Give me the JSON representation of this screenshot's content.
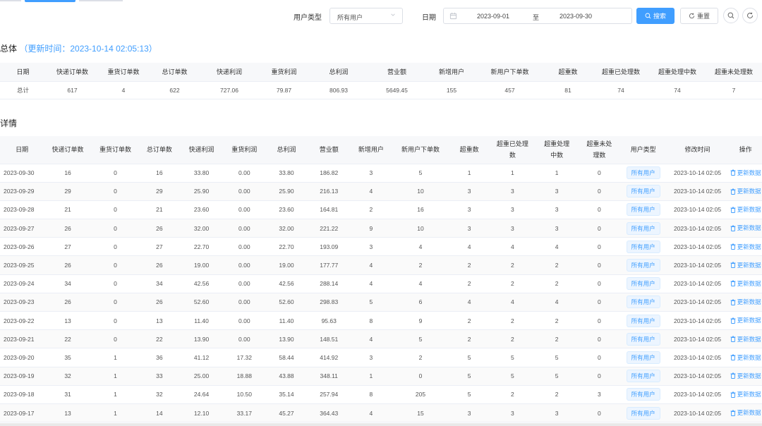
{
  "filters": {
    "user_type_label": "用户类型",
    "user_type_value": "所有用户",
    "date_label": "日期",
    "date_start": "2023-09-01",
    "date_to": "至",
    "date_end": "2023-09-30",
    "search_label": "搜索",
    "reset_label": "重置"
  },
  "overall": {
    "title_prefix": "总体",
    "update_time_label": "（更新时间：2023-10-14 02:05:13）",
    "headers": [
      "日期",
      "快递订单数",
      "重货订单数",
      "总订单数",
      "快递利润",
      "重货利润",
      "总利润",
      "营业额",
      "新增用户",
      "新用户下单数",
      "超重数",
      "超重已处理数",
      "超重处理中数",
      "超重未处理数"
    ],
    "row": [
      "总计",
      "617",
      "4",
      "622",
      "727.06",
      "79.87",
      "806.93",
      "5649.45",
      "155",
      "457",
      "81",
      "74",
      "74",
      "7"
    ]
  },
  "detail": {
    "title": "详情",
    "headers": [
      "日期",
      "快递订单数",
      "重货订单数",
      "总订单数",
      "快递利润",
      "重货利润",
      "总利润",
      "营业额",
      "新增用户",
      "新用户下单数",
      "超重数",
      "超重已处理数",
      "超重处理中数",
      "超重未处理数",
      "用户类型",
      "修改时间",
      "操作"
    ],
    "tag_label": "所有用户",
    "action_label": "更新数据",
    "modified_time": "2023-10-14 02:05",
    "rows": [
      [
        "2023-09-30",
        "16",
        "0",
        "16",
        "33.80",
        "0.00",
        "33.80",
        "186.82",
        "3",
        "5",
        "1",
        "1",
        "1",
        "0"
      ],
      [
        "2023-09-29",
        "29",
        "0",
        "29",
        "25.90",
        "0.00",
        "25.90",
        "216.13",
        "4",
        "10",
        "3",
        "3",
        "3",
        "0"
      ],
      [
        "2023-09-28",
        "21",
        "0",
        "21",
        "23.60",
        "0.00",
        "23.60",
        "164.81",
        "2",
        "16",
        "3",
        "3",
        "3",
        "0"
      ],
      [
        "2023-09-27",
        "26",
        "0",
        "26",
        "32.00",
        "0.00",
        "32.00",
        "221.22",
        "9",
        "10",
        "3",
        "3",
        "3",
        "0"
      ],
      [
        "2023-09-26",
        "27",
        "0",
        "27",
        "22.70",
        "0.00",
        "22.70",
        "193.09",
        "3",
        "4",
        "4",
        "4",
        "4",
        "0"
      ],
      [
        "2023-09-25",
        "26",
        "0",
        "26",
        "19.00",
        "0.00",
        "19.00",
        "177.77",
        "4",
        "2",
        "2",
        "2",
        "2",
        "0"
      ],
      [
        "2023-09-24",
        "34",
        "0",
        "34",
        "42.56",
        "0.00",
        "42.56",
        "288.14",
        "4",
        "4",
        "2",
        "2",
        "2",
        "0"
      ],
      [
        "2023-09-23",
        "26",
        "0",
        "26",
        "52.60",
        "0.00",
        "52.60",
        "298.83",
        "5",
        "6",
        "4",
        "4",
        "4",
        "0"
      ],
      [
        "2023-09-22",
        "13",
        "0",
        "13",
        "11.40",
        "0.00",
        "11.40",
        "95.63",
        "8",
        "9",
        "2",
        "2",
        "2",
        "0"
      ],
      [
        "2023-09-21",
        "22",
        "0",
        "22",
        "13.90",
        "0.00",
        "13.90",
        "148.51",
        "4",
        "5",
        "2",
        "2",
        "2",
        "0"
      ],
      [
        "2023-09-20",
        "35",
        "1",
        "36",
        "41.12",
        "17.32",
        "58.44",
        "414.92",
        "3",
        "2",
        "5",
        "5",
        "5",
        "0"
      ],
      [
        "2023-09-19",
        "32",
        "1",
        "33",
        "25.00",
        "18.88",
        "43.88",
        "348.11",
        "1",
        "0",
        "5",
        "5",
        "5",
        "0"
      ],
      [
        "2023-09-18",
        "31",
        "1",
        "32",
        "24.64",
        "10.50",
        "35.14",
        "257.94",
        "8",
        "205",
        "5",
        "2",
        "2",
        "3"
      ],
      [
        "2023-09-17",
        "13",
        "1",
        "14",
        "12.10",
        "33.17",
        "45.27",
        "364.43",
        "4",
        "15",
        "3",
        "3",
        "3",
        "0"
      ]
    ]
  },
  "colors": {
    "primary": "#409eff",
    "header_bg": "#f7f8fa",
    "border": "#ebeef5"
  },
  "icons": {
    "calendar": "calendar-icon",
    "search": "search-icon",
    "reset": "refresh-icon",
    "trash": "trash-icon",
    "caret": "chevron-down-icon"
  }
}
